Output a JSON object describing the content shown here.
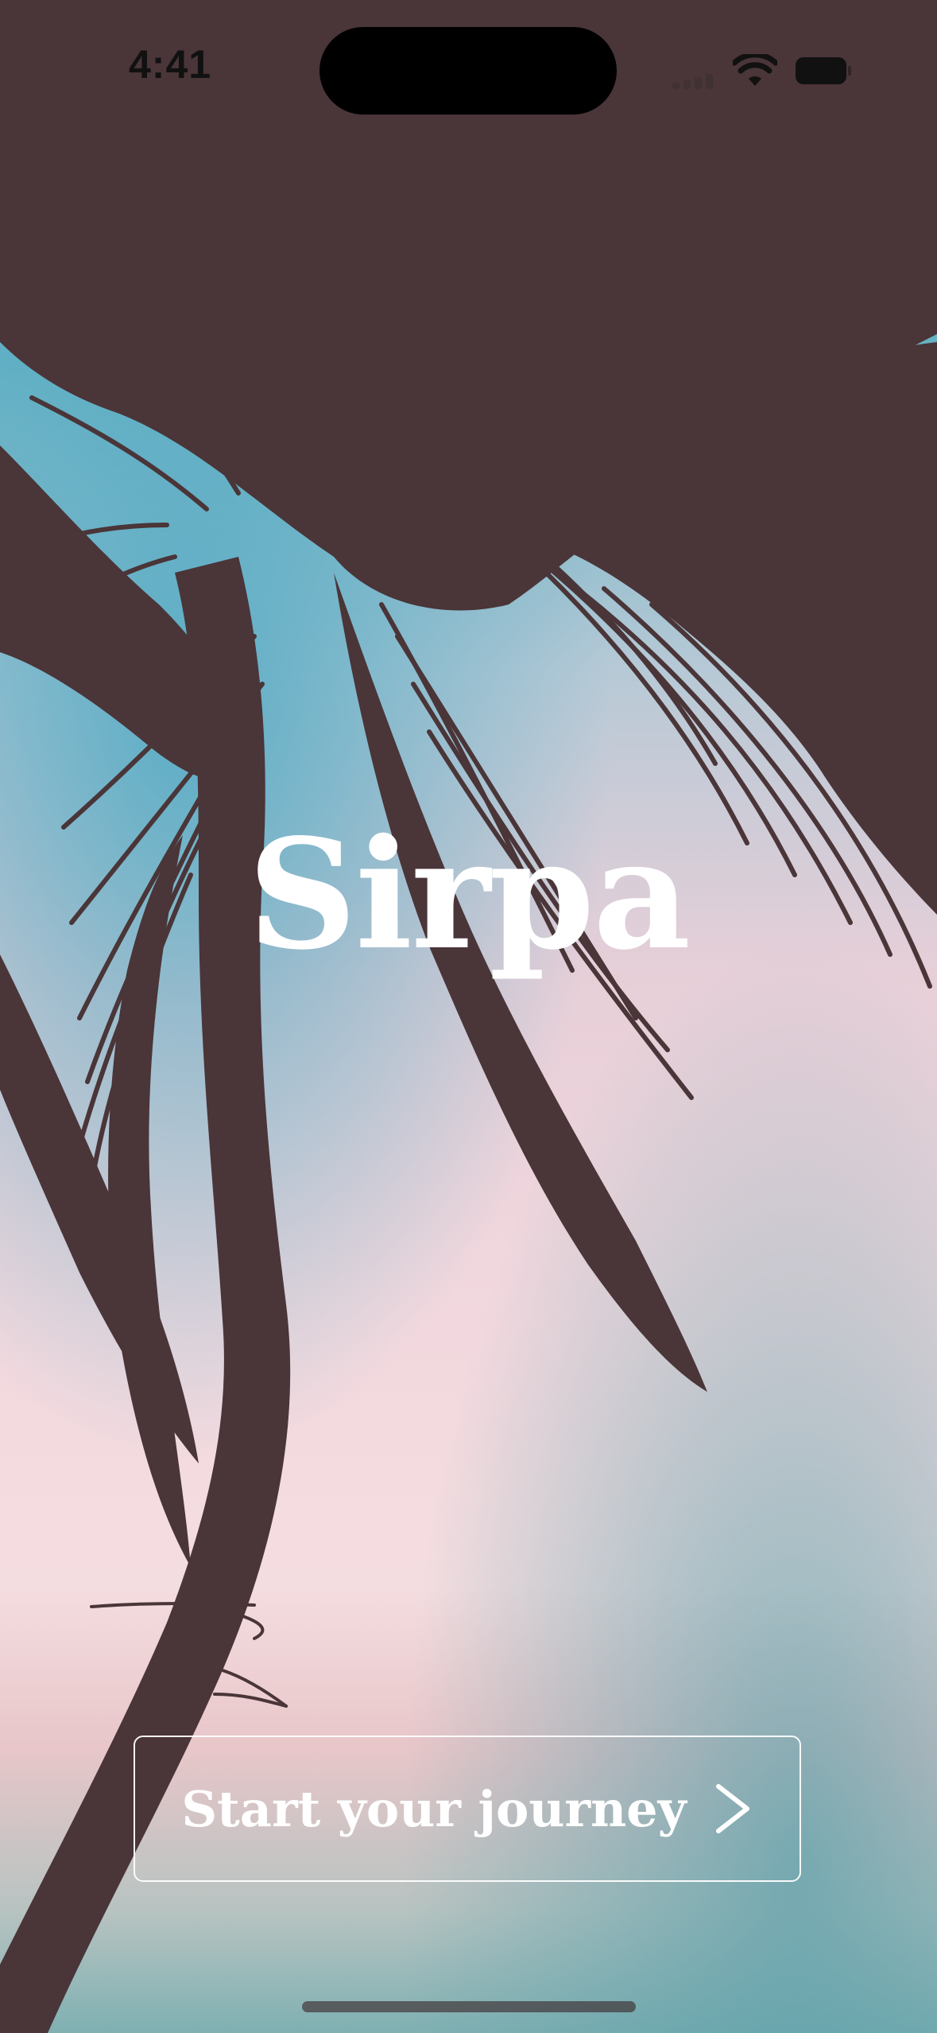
{
  "status_bar": {
    "time": "4:41",
    "wifi_icon": "wifi-icon",
    "battery_icon": "battery-icon",
    "signal_icon": "cellular-signal-icon"
  },
  "hero": {
    "title": "Sirpa"
  },
  "cta": {
    "label": "Start your journey",
    "icon": "chevron-right-icon"
  },
  "colors": {
    "silhouette": "#4a3538",
    "title": "#ffffff",
    "sky_top": "#3fa0b8",
    "sky_mid": "#f2d8de",
    "sky_bottom": "#7fb0b2"
  }
}
